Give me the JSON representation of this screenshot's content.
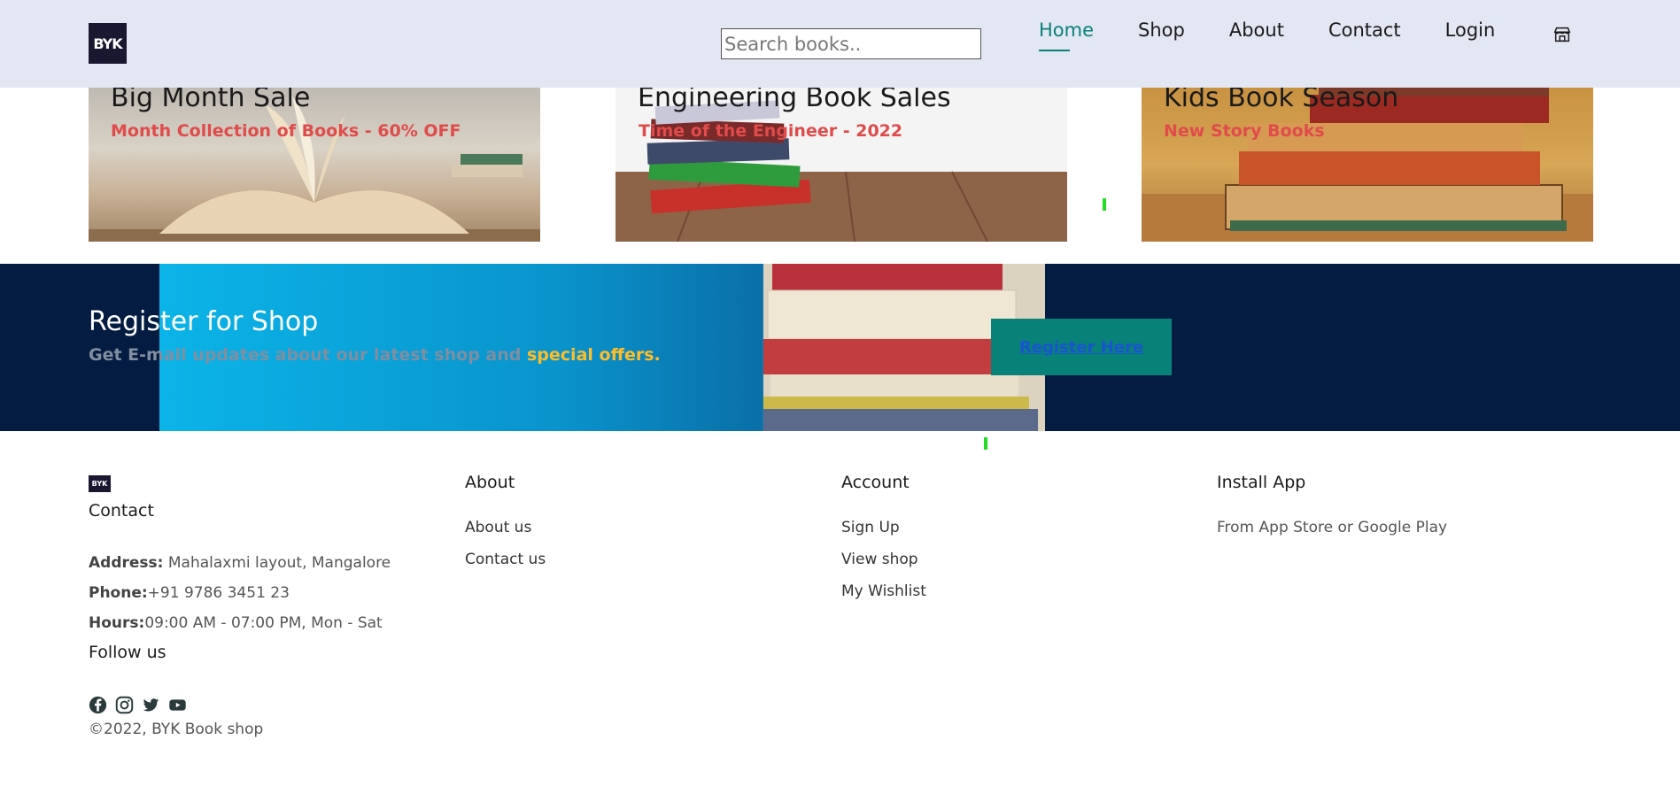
{
  "header": {
    "logo_text": "BYK",
    "search_placeholder": "Search books..",
    "nav": [
      "Home",
      "Shop",
      "About",
      "Contact",
      "Login"
    ],
    "active_nav": "Home",
    "bag_icon": "shopping-bag-icon"
  },
  "banners": [
    {
      "title": "Big Month Sale",
      "subtitle": "Month Collection of Books - 60% OFF"
    },
    {
      "title": "Engineering Book Sales",
      "subtitle": "Time of the Engineer - 2022"
    },
    {
      "title": "Kids Book Season",
      "subtitle": "New Story Books"
    }
  ],
  "newsletter": {
    "title": "Register for Shop",
    "subtitle_plain": "Get E-mail updates about our latest shop and",
    "subtitle_highlight": "special offers.",
    "button": "Register Here"
  },
  "footer": {
    "logo_text": "BYK",
    "contact_heading": "Contact",
    "address_label": "Address:",
    "address": "Mahalaxmi layout, Mangalore",
    "phone_label": "Phone:",
    "phone": "+91 9786 3451 23",
    "hours_label": "Hours:",
    "hours": "09:00 AM - 07:00 PM, Mon - Sat",
    "follow": "Follow us",
    "socials": [
      "facebook-icon",
      "instagram-icon",
      "twitter-icon",
      "youtube-icon"
    ],
    "copyright": "©2022, BYK Book shop",
    "about_heading": "About",
    "about_links": [
      "About us",
      "Contact us"
    ],
    "account_heading": "Account",
    "account_links": [
      "Sign Up",
      "View shop",
      "My Wishlist"
    ],
    "install_heading": "Install App",
    "install_text": "From App Store or Google Play"
  },
  "colors": {
    "accent": "#088178",
    "header_bg": "#e3e6f3",
    "newsletter_bg": "#041c41",
    "highlight": "#ffbd27",
    "banner_subtitle": "#e04b4b"
  }
}
